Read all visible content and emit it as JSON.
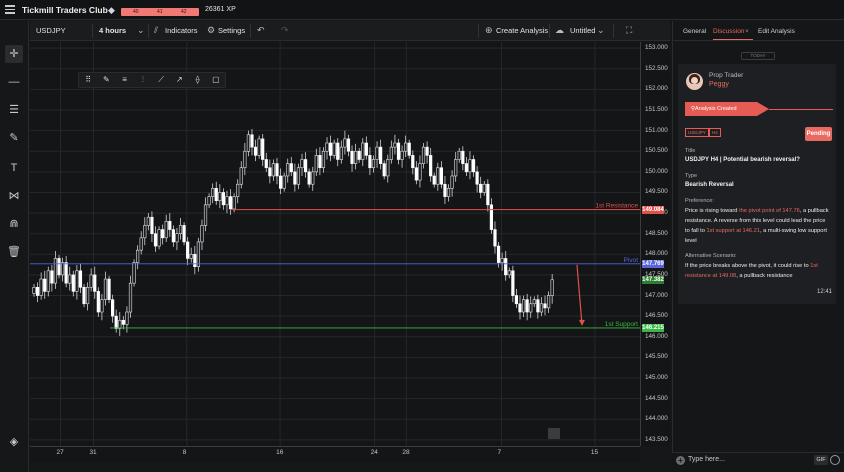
{
  "app": {
    "title": "Tickmill Traders Club",
    "xp": "26361 XP",
    "level_labels": [
      "40",
      "41",
      "42"
    ]
  },
  "toolbar": {
    "symbol": "USDJPY",
    "interval": "4 hours",
    "indicators": "Indicators",
    "settings": "Settings",
    "create_analysis": "Create Analysis",
    "untitled": "Untitled"
  },
  "left_tools": [
    "crosshair-icon",
    "horizontal-line-icon",
    "fib-retracement-icon",
    "brush-icon",
    "text-icon",
    "pattern-icon",
    "magnet-icon",
    "trash-icon",
    "layers-icon"
  ],
  "chart": {
    "levels": {
      "resistance": {
        "label": "1st Resistance",
        "price": 149.084,
        "tag": "149.084",
        "color": "#e0514a"
      },
      "pivot": {
        "label": "Pivot",
        "price": 147.769,
        "tag": "147.769",
        "color": "#5864d8"
      },
      "support": {
        "label": "1st Support",
        "price": 146.215,
        "tag": "146.215",
        "color": "#39b843"
      },
      "last": {
        "tag": "147.382",
        "color": "#2e7d32"
      }
    }
  },
  "chart_data": {
    "type": "candlestick",
    "symbol": "USDJPY",
    "interval": "4 hours",
    "y_ticks": [
      "153.000",
      "152.500",
      "152.000",
      "151.500",
      "151.000",
      "150.500",
      "150.000",
      "149.500",
      "149.000",
      "148.500",
      "148.000",
      "147.500",
      "147.000",
      "146.500",
      "146.000",
      "145.500",
      "145.000",
      "144.500",
      "144.000",
      "143.500"
    ],
    "ylim": [
      143.3,
      153.2
    ],
    "x_ticks": [
      "27",
      "31",
      "8",
      "16",
      "24",
      "28",
      "7",
      "15"
    ],
    "close_path": [
      147.2,
      147.0,
      147.4,
      147.1,
      147.6,
      147.3,
      147.9,
      147.5,
      147.8,
      147.3,
      147.5,
      147.1,
      147.6,
      147.2,
      146.8,
      147.2,
      147.5,
      147.1,
      146.6,
      146.9,
      147.4,
      146.9,
      146.5,
      146.2,
      146.4,
      146.3,
      146.6,
      147.3,
      147.8,
      148.1,
      148.4,
      148.7,
      148.9,
      148.5,
      148.2,
      148.6,
      148.4,
      148.8,
      148.6,
      148.3,
      148.5,
      148.7,
      148.3,
      147.9,
      148.0,
      147.7,
      148.3,
      148.7,
      149.2,
      149.4,
      149.6,
      149.3,
      149.5,
      149.2,
      149.4,
      149.1,
      149.4,
      149.7,
      150.1,
      150.5,
      150.9,
      150.6,
      150.4,
      150.8,
      150.3,
      150.1,
      149.9,
      150.2,
      149.9,
      149.6,
      149.9,
      150.2,
      150.0,
      149.7,
      150.1,
      150.3,
      150.0,
      149.7,
      150.0,
      150.4,
      150.1,
      150.5,
      150.7,
      150.4,
      150.7,
      150.3,
      150.6,
      150.8,
      150.5,
      150.2,
      150.5,
      150.3,
      150.7,
      150.4,
      150.1,
      150.3,
      150.6,
      150.2,
      149.9,
      150.3,
      150.6,
      150.7,
      150.3,
      150.5,
      150.7,
      150.4,
      150.1,
      149.8,
      150.2,
      150.6,
      150.4,
      149.9,
      149.7,
      150.1,
      149.7,
      149.4,
      149.6,
      149.9,
      150.3,
      150.5,
      150.2,
      150.0,
      150.3,
      150.0,
      149.7,
      149.5,
      149.7,
      149.2,
      148.6,
      148.2,
      147.8,
      147.9,
      147.5,
      147.6,
      147.0,
      146.8,
      146.6,
      146.9,
      146.6,
      146.8,
      146.9,
      146.6,
      146.8,
      146.7,
      147.0,
      147.382
    ]
  },
  "analysis": {
    "tabs": [
      "General",
      "Discussion",
      "Edit Analysis"
    ],
    "active_tab": "Discussion",
    "today": "TODAY",
    "role": "Prop Trader",
    "user": "Peggy",
    "event": "Analysis Created",
    "tags": [
      "USDJPY",
      "H4"
    ],
    "status": "Pending",
    "title_label": "Title",
    "title": "USDJPY H4 | Potential bearish reversal?",
    "type_label": "Type",
    "type": "Bearish Reversal",
    "preference_label": "Preference:",
    "preference": {
      "p1": "Price is rising toward ",
      "h1": "the pivot point of 147.76",
      "p2": ", a pullback resistance. A reverse from this level could lead the price to fall to ",
      "h2": "1st support at 146.21",
      "p3": ", a multi-swing low support level"
    },
    "alternative_label": "Alternative Scenario:",
    "alternative": {
      "p1": "If the price breaks above the pivot, it could rise to ",
      "h1": "1st resistance at 149.08",
      "p2": ", a pullback resistance"
    },
    "time": "12:41",
    "input_placeholder": "Type here...",
    "gif": "GIF"
  }
}
